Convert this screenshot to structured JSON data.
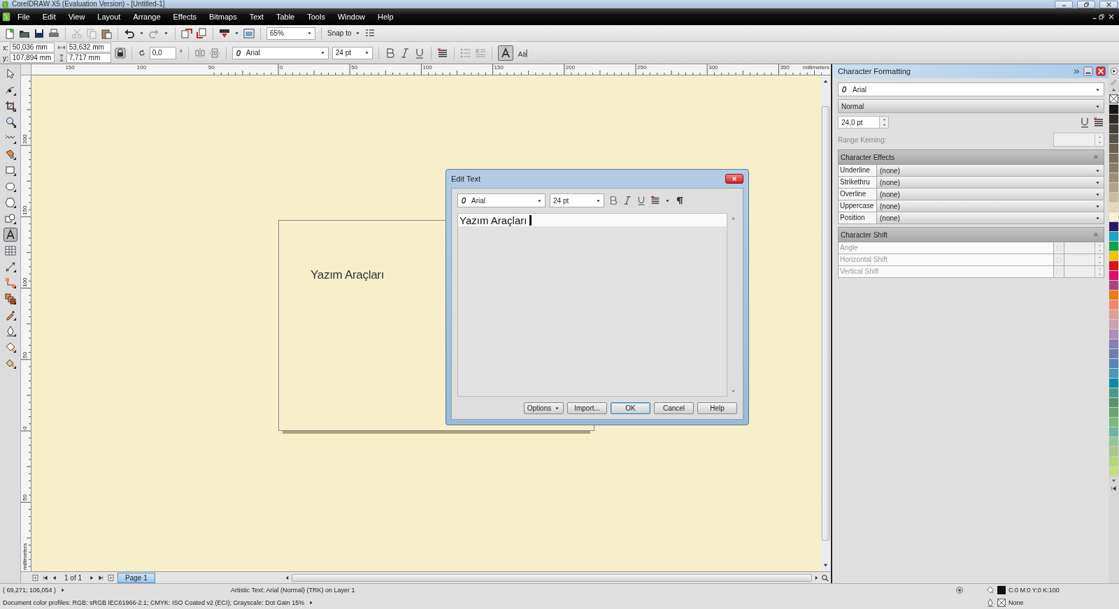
{
  "window": {
    "title": "CorelDRAW X5 (Evaluation Version) - [Untitled-1]"
  },
  "menu": [
    "File",
    "Edit",
    "View",
    "Layout",
    "Arrange",
    "Effects",
    "Bitmaps",
    "Text",
    "Table",
    "Tools",
    "Window",
    "Help"
  ],
  "standard_toolbar": {
    "zoom": "65%",
    "snap_to": "Snap to"
  },
  "property_bar": {
    "x_label": "x:",
    "x": "50,036 mm",
    "y_label": "y:",
    "y": "107,894 mm",
    "width": "53,632 mm",
    "height": "7,717 mm",
    "angle": "0,0",
    "angle_unit": "°",
    "font": "Arial",
    "size": "24 pt",
    "horizontal_text_selected": true
  },
  "rulers": {
    "horizontal": [
      "150",
      "100",
      "50",
      "0",
      "50",
      "100",
      "150",
      "200",
      "250",
      "300",
      "350"
    ],
    "horizontal_unit": "millimeters",
    "vertical": [
      "200",
      "150",
      "100",
      "50",
      "0",
      "50"
    ],
    "vertical_unit": "millimeters"
  },
  "toolbox": [
    {
      "selected": false
    },
    {
      "selected": false
    },
    {
      "selected": false
    },
    {
      "selected": false
    },
    {
      "selected": false
    },
    {
      "selected": false
    },
    {
      "selected": false
    },
    {
      "selected": false
    },
    {
      "selected": false
    },
    {
      "selected": false
    },
    {
      "selected": true
    },
    {
      "selected": false
    },
    {
      "selected": false
    },
    {
      "selected": false
    },
    {
      "selected": false
    },
    {
      "selected": false
    },
    {
      "selected": false
    },
    {
      "selected": false
    },
    {
      "selected": false
    }
  ],
  "canvas": {
    "artistic_text": "Yazım Araçları"
  },
  "edit_text_dialog": {
    "title": "Edit Text",
    "font": "Arial",
    "size": "24 pt",
    "text": "Yazım Araçları",
    "buttons": [
      {
        "label": "Options",
        "kind": "menu",
        "default": false
      },
      {
        "label": "Import...",
        "kind": "plain",
        "default": false
      },
      {
        "label": "OK",
        "kind": "plain",
        "default": true
      },
      {
        "label": "Cancel",
        "kind": "plain",
        "default": false
      },
      {
        "label": "Help",
        "kind": "plain",
        "default": false
      }
    ]
  },
  "page_navigation": {
    "counter": "1 of 1",
    "tabs": [
      {
        "label": "Page 1",
        "selected": true
      }
    ]
  },
  "docker": {
    "title": "Character Formatting",
    "font": "Arial",
    "style": "Normal",
    "size": "24,0 pt",
    "range_kerning_label": "Range Kerning:",
    "character_effects": {
      "title": "Character Effects",
      "rows": [
        {
          "label": "Underline",
          "value": "(none)"
        },
        {
          "label": "Strikethru",
          "value": "(none)"
        },
        {
          "label": "Overline",
          "value": "(none)"
        },
        {
          "label": "Uppercase",
          "value": "(none)"
        },
        {
          "label": "Position",
          "value": "(none)"
        }
      ]
    },
    "character_shift": {
      "title": "Character Shift",
      "rows": [
        {
          "label": "Angle",
          "disabled": true
        },
        {
          "label": "Horizontal Shift",
          "disabled": true
        },
        {
          "label": "Vertical Shift",
          "disabled": true
        }
      ]
    }
  },
  "palette": [
    {
      "color": "#151515"
    },
    {
      "color": "#2e2b27"
    },
    {
      "color": "#45413a"
    },
    {
      "color": "#57524a"
    },
    {
      "color": "#686252"
    },
    {
      "color": "#78705c"
    },
    {
      "color": "#887e66"
    },
    {
      "color": "#9a8f74"
    },
    {
      "color": "#b0a284"
    },
    {
      "color": "#cbbb9a"
    },
    {
      "color": "#e8d8b8"
    },
    {
      "color": "#f6f0d8"
    },
    {
      "color": "#2c1a66"
    },
    {
      "color": "#19a6c6"
    },
    {
      "color": "#12a04c"
    },
    {
      "color": "#f2c400"
    },
    {
      "color": "#d8141a"
    },
    {
      "color": "#d8106c"
    },
    {
      "color": "#a84680"
    },
    {
      "color": "#f07c10"
    },
    {
      "color": "#ee8a6a"
    },
    {
      "color": "#e0a090"
    },
    {
      "color": "#c8a2ac"
    },
    {
      "color": "#a890b6"
    },
    {
      "color": "#8a7eb4"
    },
    {
      "color": "#6e7cb0"
    },
    {
      "color": "#5a86b6"
    },
    {
      "color": "#4a9ab6"
    },
    {
      "color": "#0e8aa8"
    },
    {
      "color": "#4c9a8a"
    },
    {
      "color": "#56946c"
    },
    {
      "color": "#6aa474"
    },
    {
      "color": "#7cb880"
    },
    {
      "color": "#6eb4a0"
    },
    {
      "color": "#96c49a"
    },
    {
      "color": "#a8c884"
    },
    {
      "color": "#b6d478"
    },
    {
      "color": "#c4e07a"
    }
  ],
  "status_bar": {
    "coordinates": "( 69,271; 106,054 )",
    "object_info": "Artistic Text: Arial (Normal) (TRK) on Layer 1",
    "color_profiles": "Document color profiles: RGB: sRGB IEC61966-2.1; CMYK: ISO Coated v2 (ECI); Grayscale: Dot Gain 15%",
    "fill": {
      "label": "C:0 M:0 Y:0 K:100",
      "color": "#111111"
    },
    "outline": {
      "label": "None"
    }
  }
}
